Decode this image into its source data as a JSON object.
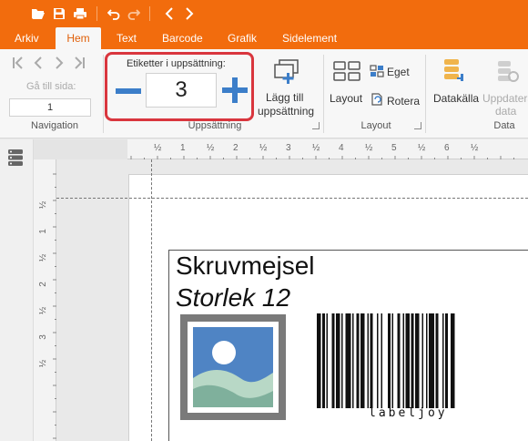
{
  "tabs": [
    {
      "label": "Arkiv",
      "active": false
    },
    {
      "label": "Hem",
      "active": true
    },
    {
      "label": "Text",
      "active": false
    },
    {
      "label": "Barcode",
      "active": false
    },
    {
      "label": "Grafik",
      "active": false
    },
    {
      "label": "Sidelement",
      "active": false
    }
  ],
  "ribbon": {
    "navigation": {
      "goto_label": "Gå till sida:",
      "goto_value": "1",
      "group_label": "Navigation"
    },
    "setup": {
      "spin_label": "Etiketter i uppsättning:",
      "spin_value": "3",
      "add_line1": "Lägg till",
      "add_line2": "uppsättning",
      "group_label": "Uppsättning"
    },
    "layout": {
      "layout_label": "Layout",
      "custom_label": "Eget",
      "rotate_label": "Rotera",
      "group_label": "Layout"
    },
    "data": {
      "datasource_label": "Datakälla",
      "update_line1": "Uppdatera",
      "update_line2": "data",
      "group_label": "Data"
    }
  },
  "ruler": {
    "h_labels": [
      "½",
      "1",
      "½",
      "2",
      "½",
      "3",
      "½",
      "4",
      "½",
      "5",
      "½",
      "6",
      "½"
    ],
    "v_labels": [
      "½",
      "1",
      "½",
      "2",
      "½",
      "3",
      "½"
    ]
  },
  "label": {
    "title": "Skruvmejsel",
    "subtitle": "Storlek 12",
    "barcode_text": "labeljoy"
  },
  "colors": {
    "accent": "#f26c0d",
    "highlight": "#d9363e",
    "spin_buttons": "#3c7ec9"
  }
}
